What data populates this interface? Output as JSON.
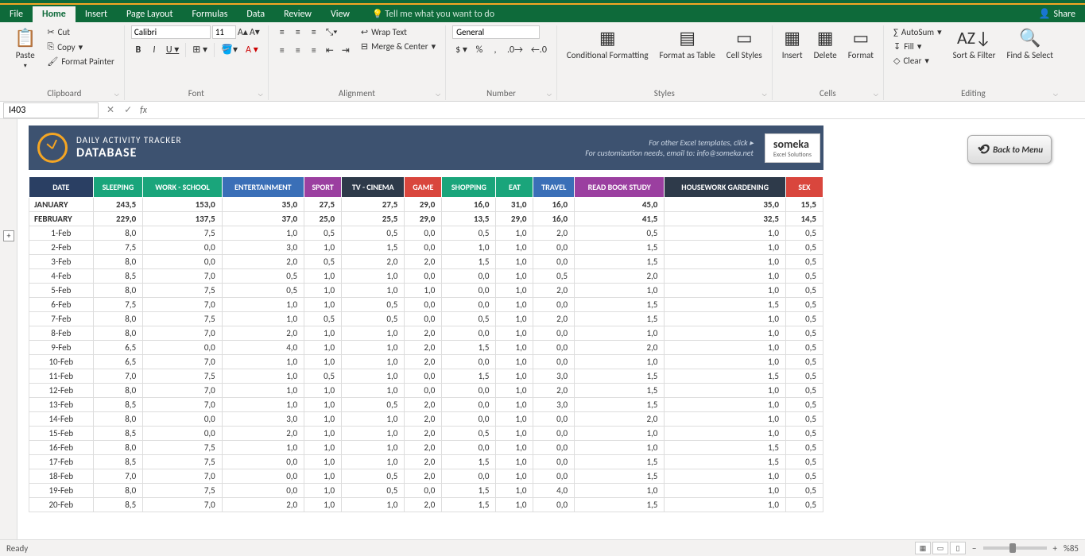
{
  "app": {
    "share": "Share",
    "tell_me": "Tell me what you want to do"
  },
  "tabs": [
    "File",
    "Home",
    "Insert",
    "Page Layout",
    "Formulas",
    "Data",
    "Review",
    "View"
  ],
  "active_tab": "Home",
  "ribbon": {
    "clipboard": {
      "label": "Clipboard",
      "paste": "Paste",
      "cut": "Cut",
      "copy": "Copy",
      "format_painter": "Format Painter"
    },
    "font": {
      "label": "Font",
      "name": "Calibri",
      "size": "11"
    },
    "alignment": {
      "label": "Alignment",
      "wrap": "Wrap Text",
      "merge": "Merge & Center"
    },
    "number": {
      "label": "Number",
      "format": "General"
    },
    "styles": {
      "label": "Styles",
      "cond": "Conditional Formatting",
      "table": "Format as Table",
      "cell": "Cell Styles"
    },
    "cells": {
      "label": "Cells",
      "insert": "Insert",
      "delete": "Delete",
      "format": "Format"
    },
    "editing": {
      "label": "Editing",
      "autosum": "AutoSum",
      "fill": "Fill",
      "clear": "Clear",
      "sort": "Sort & Filter",
      "find": "Find & Select"
    }
  },
  "namebox": "I403",
  "banner": {
    "subtitle": "DAILY ACTIVITY TRACKER",
    "title": "DATABASE",
    "info1": "For other Excel templates, click ▸",
    "info2": "For customization needs, email to: info@someka.net",
    "brand": "someka",
    "brand_sub": "Excel Solutions"
  },
  "back_button": "Back to Menu",
  "columns": [
    {
      "label": "DATE",
      "color": "#2a3f63"
    },
    {
      "label": "SLEEPING",
      "color": "#1aa57b"
    },
    {
      "label": "WORK - SCHOOL",
      "color": "#1aa57b"
    },
    {
      "label": "ENTERTAINMENT",
      "color": "#3a6fb7"
    },
    {
      "label": "SPORT",
      "color": "#9b3fa0"
    },
    {
      "label": "TV - CINEMA",
      "color": "#2e3a4a"
    },
    {
      "label": "GAME",
      "color": "#d9463d"
    },
    {
      "label": "SHOPPING",
      "color": "#1aa57b"
    },
    {
      "label": "EAT",
      "color": "#1aa57b"
    },
    {
      "label": "TRAVEL",
      "color": "#3a6fb7"
    },
    {
      "label": "READ BOOK STUDY",
      "color": "#9b3fa0"
    },
    {
      "label": "HOUSEWORK GARDENING",
      "color": "#2e3a4a"
    },
    {
      "label": "SEX",
      "color": "#d9463d"
    }
  ],
  "summary_rows": [
    {
      "label": "JANUARY",
      "vals": [
        "243,5",
        "153,0",
        "35,0",
        "27,5",
        "27,5",
        "29,0",
        "16,0",
        "31,0",
        "16,0",
        "45,0",
        "35,0",
        "15,5"
      ]
    },
    {
      "label": "FEBRUARY",
      "vals": [
        "229,0",
        "137,5",
        "37,0",
        "25,0",
        "25,5",
        "29,0",
        "13,5",
        "29,0",
        "16,0",
        "41,5",
        "32,5",
        "14,5"
      ]
    }
  ],
  "data_rows": [
    {
      "date": "1-Feb",
      "vals": [
        "8,0",
        "7,5",
        "1,0",
        "0,5",
        "0,5",
        "0,0",
        "0,5",
        "1,0",
        "2,0",
        "0,5",
        "1,0",
        "0,5"
      ]
    },
    {
      "date": "2-Feb",
      "vals": [
        "7,5",
        "0,0",
        "3,0",
        "1,0",
        "1,5",
        "0,0",
        "1,0",
        "1,0",
        "0,0",
        "1,5",
        "1,0",
        "0,5"
      ]
    },
    {
      "date": "3-Feb",
      "vals": [
        "8,0",
        "0,0",
        "2,0",
        "0,5",
        "2,0",
        "2,0",
        "1,5",
        "1,0",
        "0,0",
        "1,5",
        "1,0",
        "0,5"
      ]
    },
    {
      "date": "4-Feb",
      "vals": [
        "8,5",
        "7,0",
        "0,5",
        "1,0",
        "1,0",
        "0,0",
        "0,0",
        "1,0",
        "0,5",
        "2,0",
        "1,0",
        "0,5"
      ]
    },
    {
      "date": "5-Feb",
      "vals": [
        "8,0",
        "7,5",
        "0,5",
        "1,0",
        "1,0",
        "1,0",
        "0,0",
        "1,0",
        "2,0",
        "1,0",
        "1,0",
        "0,5"
      ]
    },
    {
      "date": "6-Feb",
      "vals": [
        "7,5",
        "7,0",
        "1,0",
        "1,0",
        "0,5",
        "0,0",
        "0,0",
        "1,0",
        "0,0",
        "1,5",
        "1,5",
        "0,5"
      ]
    },
    {
      "date": "7-Feb",
      "vals": [
        "8,0",
        "7,5",
        "1,0",
        "0,5",
        "0,5",
        "0,0",
        "0,5",
        "1,0",
        "2,0",
        "1,5",
        "1,0",
        "0,5"
      ]
    },
    {
      "date": "8-Feb",
      "vals": [
        "8,0",
        "7,0",
        "2,0",
        "1,0",
        "1,0",
        "2,0",
        "0,0",
        "1,0",
        "0,0",
        "1,0",
        "1,0",
        "0,5"
      ]
    },
    {
      "date": "9-Feb",
      "vals": [
        "6,5",
        "0,0",
        "4,0",
        "1,0",
        "1,0",
        "2,0",
        "1,5",
        "1,0",
        "0,0",
        "2,0",
        "1,0",
        "0,5"
      ]
    },
    {
      "date": "10-Feb",
      "vals": [
        "6,5",
        "7,0",
        "1,0",
        "1,0",
        "1,0",
        "2,0",
        "0,0",
        "1,0",
        "0,0",
        "1,0",
        "1,0",
        "0,5"
      ]
    },
    {
      "date": "11-Feb",
      "vals": [
        "7,0",
        "7,5",
        "1,0",
        "0,5",
        "1,0",
        "0,0",
        "1,5",
        "1,0",
        "3,0",
        "1,5",
        "1,5",
        "0,5"
      ]
    },
    {
      "date": "12-Feb",
      "vals": [
        "8,0",
        "7,0",
        "1,0",
        "1,0",
        "1,0",
        "0,0",
        "0,0",
        "1,0",
        "2,0",
        "1,5",
        "1,0",
        "0,5"
      ]
    },
    {
      "date": "13-Feb",
      "vals": [
        "8,5",
        "7,0",
        "1,0",
        "1,0",
        "0,5",
        "2,0",
        "0,0",
        "1,0",
        "3,0",
        "1,5",
        "1,0",
        "0,5"
      ]
    },
    {
      "date": "14-Feb",
      "vals": [
        "8,0",
        "0,0",
        "3,0",
        "1,0",
        "1,0",
        "2,0",
        "0,0",
        "1,0",
        "0,0",
        "2,0",
        "1,0",
        "0,5"
      ]
    },
    {
      "date": "15-Feb",
      "vals": [
        "8,5",
        "0,0",
        "2,0",
        "1,0",
        "1,0",
        "2,0",
        "0,5",
        "1,0",
        "0,0",
        "1,0",
        "1,0",
        "0,5"
      ]
    },
    {
      "date": "16-Feb",
      "vals": [
        "8,0",
        "7,5",
        "1,0",
        "1,0",
        "1,0",
        "2,0",
        "0,0",
        "1,0",
        "0,0",
        "1,0",
        "1,5",
        "0,5"
      ]
    },
    {
      "date": "17-Feb",
      "vals": [
        "8,5",
        "7,5",
        "0,0",
        "1,0",
        "1,0",
        "2,0",
        "1,5",
        "1,0",
        "0,0",
        "1,5",
        "1,5",
        "0,5"
      ]
    },
    {
      "date": "18-Feb",
      "vals": [
        "7,0",
        "7,0",
        "0,0",
        "1,0",
        "0,5",
        "2,0",
        "0,0",
        "1,0",
        "0,0",
        "1,5",
        "1,0",
        "0,5"
      ]
    },
    {
      "date": "19-Feb",
      "vals": [
        "8,0",
        "7,5",
        "0,0",
        "1,0",
        "0,5",
        "0,0",
        "1,5",
        "1,0",
        "4,0",
        "1,0",
        "1,0",
        "0,5"
      ]
    },
    {
      "date": "20-Feb",
      "vals": [
        "8,5",
        "7,0",
        "2,0",
        "1,0",
        "1,0",
        "2,0",
        "1,5",
        "1,0",
        "0,0",
        "1,5",
        "1,0",
        "0,5"
      ]
    }
  ],
  "status": {
    "ready": "Ready",
    "zoom": "%85"
  }
}
